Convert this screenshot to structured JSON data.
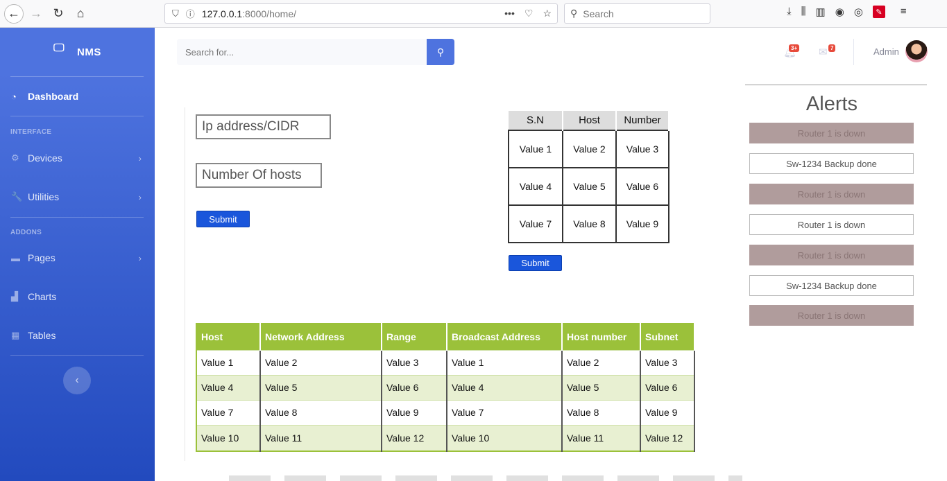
{
  "browser": {
    "url_host": "127.0.0.1",
    "url_path": ":8000/home/",
    "search_placeholder": "Search",
    "url_menu": "•••"
  },
  "sidebar": {
    "brand": "NMS",
    "items": [
      {
        "label": "Dashboard",
        "icon": "tachometer-icon"
      },
      {
        "label": "Devices",
        "icon": "cog-icon"
      },
      {
        "label": "Utilities",
        "icon": "wrench-icon"
      },
      {
        "label": "Pages",
        "icon": "folder-icon"
      },
      {
        "label": "Charts",
        "icon": "chart-area-icon"
      },
      {
        "label": "Tables",
        "icon": "table-icon"
      }
    ],
    "headings": {
      "interface": "INTERFACE",
      "addons": "ADDONS"
    }
  },
  "topbar": {
    "search_placeholder": "Search for...",
    "alerts_badge": "3+",
    "messages_badge": "7",
    "user_name": "Admin"
  },
  "form": {
    "ip_placeholder": "Ip address/CIDR",
    "hosts_placeholder": "Number Of hosts",
    "submit_label": "Submit"
  },
  "small_table": {
    "headers": [
      "S.N",
      "Host",
      "Number"
    ],
    "rows": [
      [
        "Value 1",
        "Value 2",
        "Value 3"
      ],
      [
        "Value 4",
        "Value 5",
        "Value 6"
      ],
      [
        "Value 7",
        "Value 8",
        "Value 9"
      ]
    ],
    "submit_label": "Submit"
  },
  "subnet_table": {
    "headers": [
      "Host",
      "Network Address",
      "Range",
      "Broadcast Address",
      "Host number",
      "Subnet"
    ],
    "rows": [
      [
        "Value 1",
        "Value 2",
        "Value 3",
        "Value 1",
        "Value 2",
        "Value 3"
      ],
      [
        "Value 4",
        "Value 5",
        "Value 6",
        "Value 4",
        "Value 5",
        "Value 6"
      ],
      [
        "Value 7",
        "Value 8",
        "Value 9",
        "Value 7",
        "Value 8",
        "Value 9"
      ],
      [
        "Value 10",
        "Value 11",
        "Value 12",
        "Value 10",
        "Value 11",
        "Value 12"
      ]
    ]
  },
  "alerts": {
    "title": "Alerts",
    "items": [
      {
        "text": "Router 1 is down",
        "style": "dark"
      },
      {
        "text": "Sw-1234 Backup done",
        "style": "light"
      },
      {
        "text": "Router 1 is down",
        "style": "dark"
      },
      {
        "text": "Router 1 is down",
        "style": "light"
      },
      {
        "text": "Router 1 is down",
        "style": "dark"
      },
      {
        "text": "Sw-1234 Backup done",
        "style": "light"
      },
      {
        "text": "Router 1 is down",
        "style": "dark"
      }
    ]
  }
}
